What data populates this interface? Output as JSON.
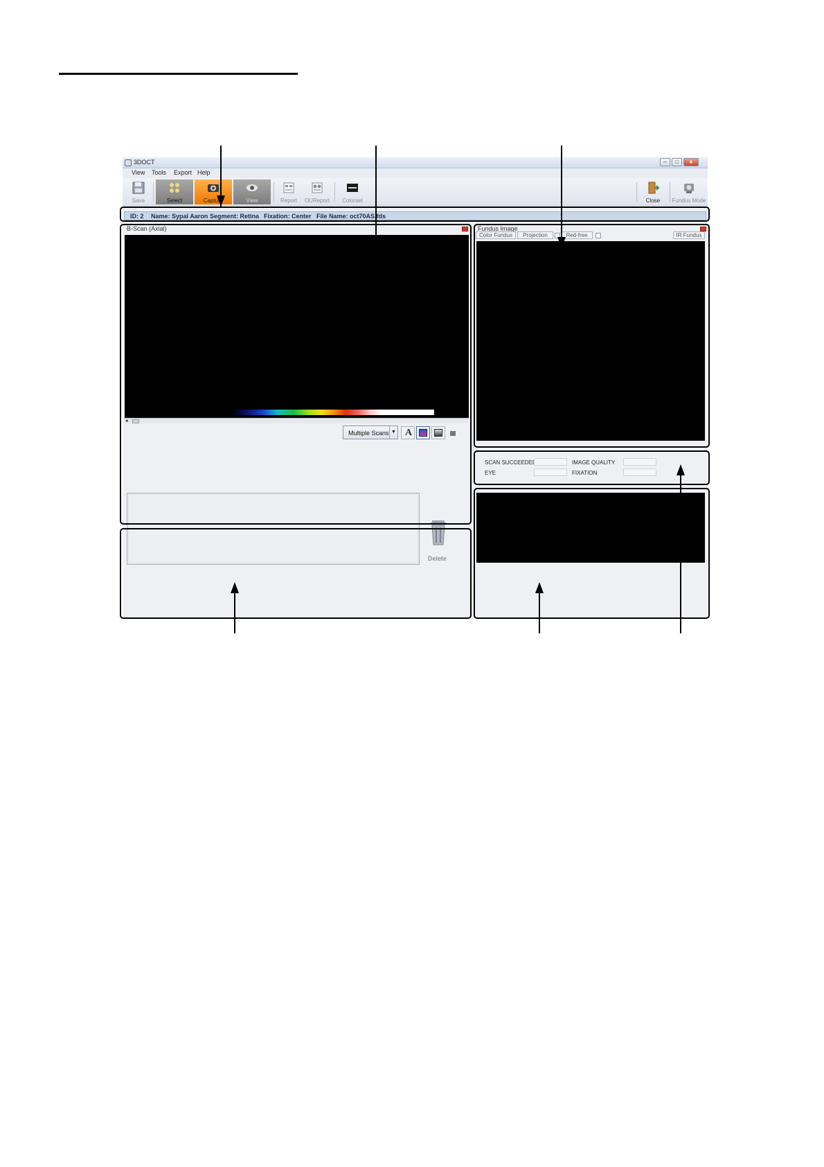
{
  "window": {
    "title": "3DOCT"
  },
  "menu": [
    "View",
    "Tools",
    "Export",
    "Help"
  ],
  "toolbar": {
    "save": "Save",
    "select": "Select",
    "capture": "Capture",
    "view": "View",
    "report": "Report",
    "oureport": "OUReport",
    "colorset": "Colorset",
    "close": "Close",
    "fundus_mode": "Fundus Mode"
  },
  "info_bar": {
    "id": "ID: 2",
    "name": "Name: Sypal Aaron",
    "segment": "Segment: Retina",
    "fixation": "Fixation: Center",
    "file_name": "File Name: oct70AS.fds"
  },
  "bscan": {
    "title": "B-Scan (Axial)",
    "dropdown": "Multiple Scans"
  },
  "thumbnails": {
    "delete_label": "Delete"
  },
  "fundus": {
    "title": "Fundus Image",
    "tabs": [
      "Color Fundus",
      "Projection",
      "Red-free",
      "IR Fundus"
    ]
  },
  "status": {
    "scan_succeeded": "SCAN SUCCEEDED",
    "image_quality": "IMAGE QUALITY",
    "eye": "EYE",
    "fixation": "FIXATION"
  },
  "icons": {
    "window": "app-icon",
    "save": "floppy-icon",
    "select": "grid-icon",
    "capture": "camera-icon",
    "view": "eye-icon",
    "report": "report-icon",
    "oureport": "ou-report-icon",
    "colorset": "colorset-icon",
    "close": "door-exit-icon",
    "fundus_mode": "fundus-camera-icon",
    "delete": "trash-icon",
    "text_tool": "letter-a-icon"
  },
  "colors": {
    "capture_active": "#f07800",
    "info_bar": "#c9d7ea"
  }
}
